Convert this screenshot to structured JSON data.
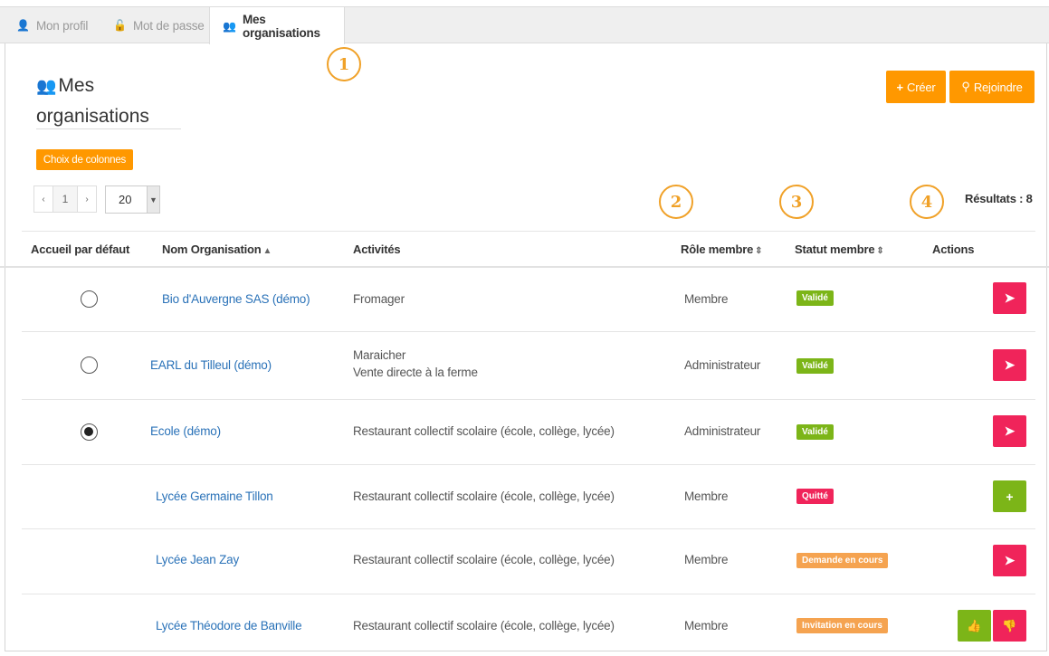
{
  "tabs": [
    {
      "label": "Mon profil",
      "icon": "user-icon"
    },
    {
      "label": "Mot de passe",
      "icon": "lock-icon"
    },
    {
      "label": "Mes organisations",
      "icon": "users-icon"
    }
  ],
  "callouts": [
    "1",
    "2",
    "3",
    "4"
  ],
  "page": {
    "title_line1": "Mes",
    "title_line2": "organisations",
    "create_label": "Créer",
    "join_label": "Rejoindre",
    "columns_label": "Choix de colonnes",
    "results_label": "Résultats : 8"
  },
  "pagination": {
    "prev": "‹",
    "page": "1",
    "next": "›",
    "per_page": "20"
  },
  "columns": {
    "default_home": "Accueil par défaut",
    "org_name": "Nom Organisation",
    "activities": "Activités",
    "member_role": "Rôle membre",
    "member_status": "Statut membre",
    "actions": "Actions"
  },
  "rows": [
    {
      "name": "Bio d'Auvergne SAS (démo)",
      "activity1": "Fromager",
      "activity2": "",
      "role": "Membre",
      "status": "Validé",
      "status_color": "#7cb518",
      "radio": "unchecked",
      "actions": [
        "leave"
      ]
    },
    {
      "name": "EARL du Tilleul (démo)",
      "activity1": "Maraicher",
      "activity2": "Vente directe à la ferme",
      "role": "Administrateur",
      "status": "Validé",
      "status_color": "#7cb518",
      "radio": "unchecked",
      "actions": [
        "leave"
      ]
    },
    {
      "name": "Ecole (démo)",
      "activity1": "Restaurant collectif scolaire (école, collège, lycée)",
      "activity2": "",
      "role": "Administrateur",
      "status": "Validé",
      "status_color": "#7cb518",
      "radio": "checked",
      "actions": [
        "leave"
      ]
    },
    {
      "name": "Lycée Germaine Tillon",
      "activity1": "Restaurant collectif scolaire (école, collège, lycée)",
      "activity2": "",
      "role": "Membre",
      "status": "Quitté",
      "status_color": "#f0245a",
      "radio": "none",
      "actions": [
        "rejoin"
      ]
    },
    {
      "name": "Lycée Jean Zay",
      "activity1": "Restaurant collectif scolaire (école, collège, lycée)",
      "activity2": "",
      "role": "Membre",
      "status": "Demande en cours",
      "status_color": "#f5a350",
      "radio": "none",
      "actions": [
        "leave"
      ]
    },
    {
      "name": "Lycée Théodore de Banville",
      "activity1": "Restaurant collectif scolaire (école, collège, lycée)",
      "activity2": "",
      "role": "Membre",
      "status": "Invitation en cours",
      "status_color": "#f5a350",
      "radio": "none",
      "actions": [
        "accept",
        "decline"
      ]
    }
  ],
  "colors": {
    "accent": "#ff9800",
    "link": "#2a72b8",
    "success": "#7cb518",
    "danger": "#f0245a",
    "warning": "#f5a350",
    "callout": "#f0a128"
  }
}
